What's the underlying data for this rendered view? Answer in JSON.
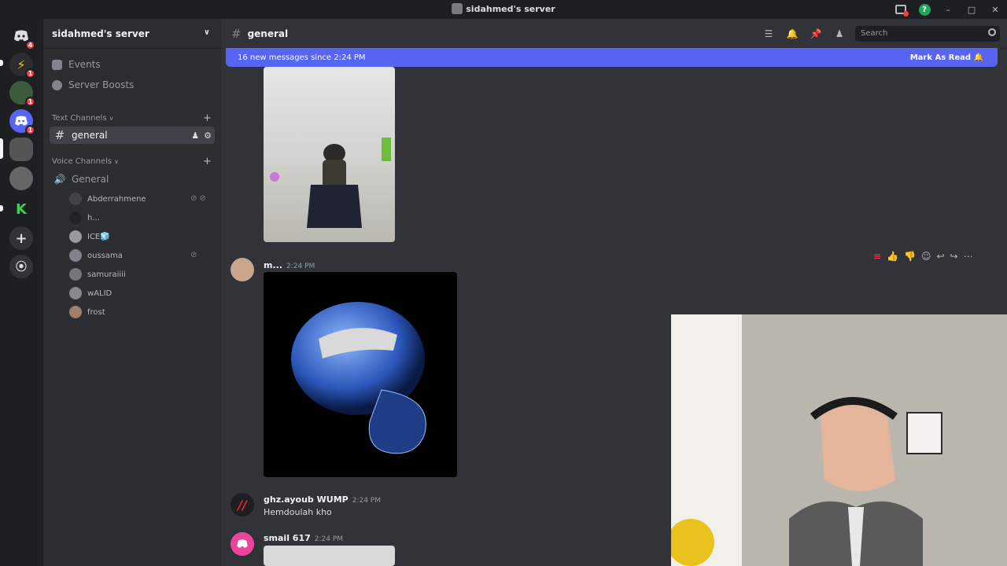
{
  "window": {
    "title": "sidahmed's server"
  },
  "servers": [
    {
      "name": "home",
      "badge": "4",
      "color": "#1e1f22"
    },
    {
      "name": "server-lightning",
      "badge": "1",
      "color": "#2b2d31"
    },
    {
      "name": "server-green",
      "badge": "1",
      "color": "#3c5a3c"
    },
    {
      "name": "server-discord",
      "badge": "1",
      "color": "#5865f2"
    },
    {
      "name": "server-photo-1",
      "badge": "",
      "color": "#555"
    },
    {
      "name": "server-photo-2",
      "badge": "",
      "color": "#666"
    },
    {
      "name": "server-k",
      "badge": "",
      "color": "#1e1f22"
    }
  ],
  "sidebar": {
    "server_name": "sidahmed's server",
    "events_label": "Events",
    "boosts_label": "Server Boosts",
    "text_category": "Text Channels",
    "voice_category": "Voice Channels",
    "text_channels": [
      {
        "name": "general"
      }
    ],
    "voice_channel": "General",
    "voice_users": [
      {
        "name": "Abderrahmene",
        "color": "#444"
      },
      {
        "name": "h...",
        "color": "#222"
      },
      {
        "name": "ICE🧊",
        "color": "#999"
      },
      {
        "name": "oussama",
        "color": "#80848e"
      },
      {
        "name": "samuraiiii",
        "color": "#777"
      },
      {
        "name": "wALID",
        "color": "#888"
      },
      {
        "name": "frost",
        "color": "#a0806a"
      }
    ]
  },
  "chat": {
    "channel_name": "general",
    "search_placeholder": "Search",
    "new_messages": "16 new messages since 2:24 PM",
    "mark_as_read": "Mark As Read",
    "messages": [
      {
        "author": "m...",
        "time": "2:24 PM",
        "text": ""
      },
      {
        "author": "ghz.ayoub WUMP",
        "time": "2:24 PM",
        "text": "Hemdoulah kho"
      },
      {
        "author": "smail 617",
        "time": "2:24 PM",
        "text": ""
      }
    ]
  },
  "colors": {
    "accent": "#5865f2",
    "unread": "#f23f43",
    "online": "#23a55a"
  }
}
